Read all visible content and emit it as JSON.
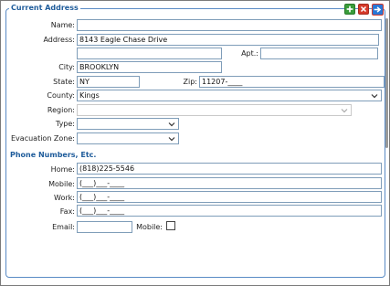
{
  "section_current_address": "Current Address",
  "toolbar": {
    "add_icon": "plus-icon",
    "delete_icon": "close-icon",
    "next_icon": "arrow-right-icon"
  },
  "address": {
    "name_label": "Name:",
    "name_value": "",
    "address_label": "Address:",
    "address_value": "8143 Eagle Chase Drive",
    "address2_value": "",
    "apt_label": "Apt.:",
    "apt_value": "",
    "city_label": "City:",
    "city_value": "BROOKLYN",
    "state_label": "State:",
    "state_value": "NY",
    "zip_label": "Zip:",
    "zip_value": "11207-____",
    "county_label": "County:",
    "county_value": "Kings",
    "region_label": "Region:",
    "region_value": "",
    "type_label": "Type:",
    "type_value": "",
    "evac_label": "Evacuation Zone:",
    "evac_value": ""
  },
  "section_phone": "Phone Numbers, Etc.",
  "phone": {
    "home_label": "Home:",
    "home_value": "(818)225-5546",
    "mobile_label": "Mobile:",
    "mobile_value": "(___)___-____",
    "work_label": "Work:",
    "work_value": "(___)___-____",
    "fax_label": "Fax:",
    "fax_value": "(___)___-____",
    "email_label": "Email:",
    "email_value": "",
    "email_mobile_label": "Mobile:"
  },
  "colors": {
    "section": "#1f5c9b",
    "field_border": "#7f9db9",
    "add": "#3a9d3a",
    "delete": "#d63a2a",
    "next": "#2a78d6"
  }
}
